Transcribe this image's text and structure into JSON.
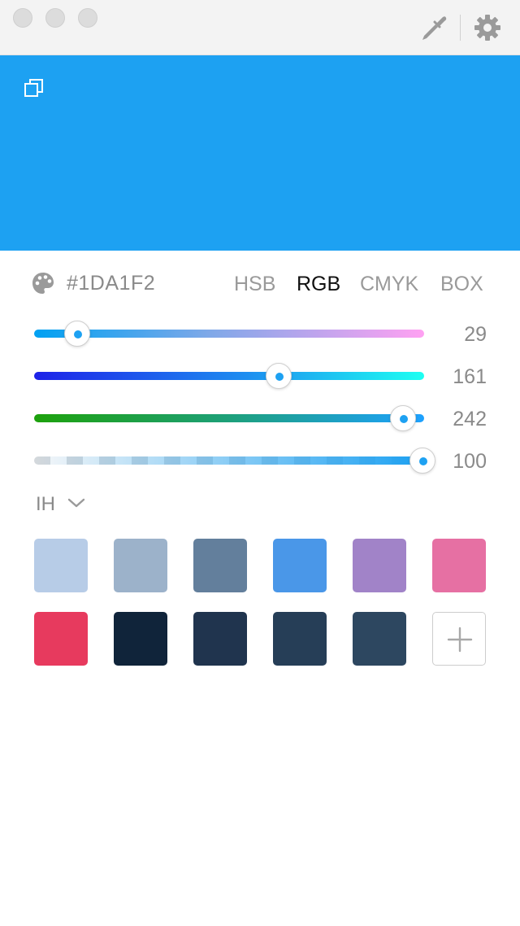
{
  "window": {
    "traffic_lights": [
      "close",
      "minimize",
      "zoom"
    ],
    "toolbar_icons": [
      "eyedropper-icon",
      "gear-icon"
    ]
  },
  "preview": {
    "color": "#1DA1F2",
    "icon": "copy-icon"
  },
  "color": {
    "hex": "#1DA1F2",
    "palette_icon": "palette-icon",
    "modes": [
      "HSB",
      "RGB",
      "CMYK",
      "BOX"
    ],
    "active_mode": "RGB"
  },
  "sliders": {
    "red": {
      "value": "29",
      "fraction": 0.1137
    },
    "green": {
      "value": "161",
      "fraction": 0.6314
    },
    "blue": {
      "value": "242",
      "fraction": 0.949
    },
    "alpha": {
      "value": "100",
      "fraction": 1.0
    }
  },
  "palette_set": {
    "name": "IH",
    "icon": "chevron-down-icon"
  },
  "swatches": [
    "#B7CCE7",
    "#9CB2CA",
    "#637F9C",
    "#4A97E8",
    "#A183C8",
    "#E670A3",
    "#E73A5E",
    "#10243A",
    "#20344E",
    "#263E57",
    "#2D4760"
  ],
  "add_swatch_icon": "plus-icon"
}
